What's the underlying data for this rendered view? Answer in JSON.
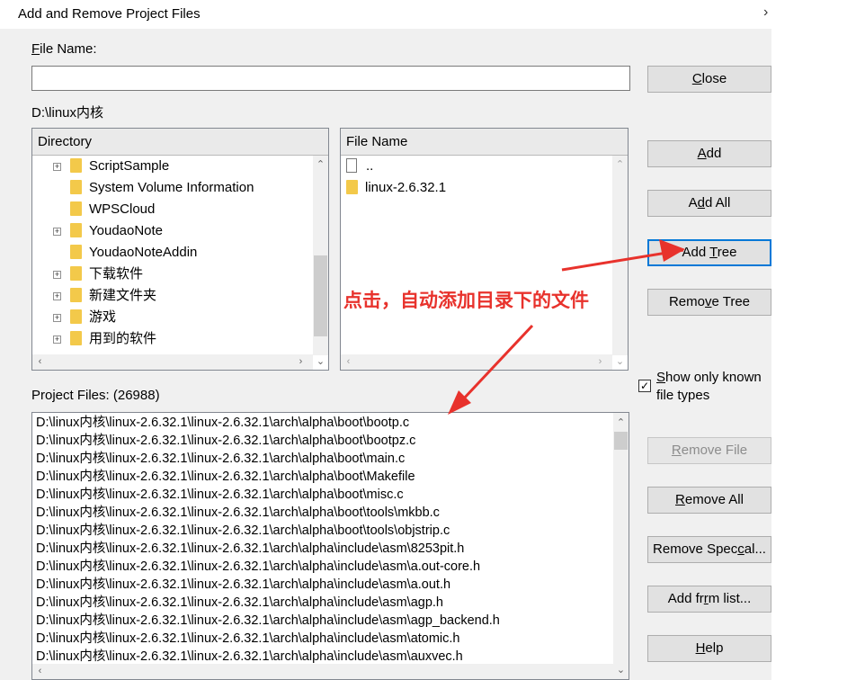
{
  "window": {
    "title": "Add and Remove Project Files",
    "close_glyph": "›"
  },
  "file_name": {
    "label": "File Name:",
    "value": ""
  },
  "current_path": "D:\\linux内核",
  "directory": {
    "header": "Directory",
    "items": [
      {
        "label": "ScriptSample",
        "expandable": true
      },
      {
        "label": "System Volume Information",
        "expandable": false
      },
      {
        "label": "WPSCloud",
        "expandable": false
      },
      {
        "label": "YoudaoNote",
        "expandable": true
      },
      {
        "label": "YoudaoNoteAddin",
        "expandable": false
      },
      {
        "label": "下载软件",
        "expandable": true
      },
      {
        "label": "新建文件夹",
        "expandable": true
      },
      {
        "label": "游戏",
        "expandable": true
      },
      {
        "label": "用到的软件",
        "expandable": true
      }
    ]
  },
  "file_list": {
    "header": "File Name",
    "items": [
      {
        "label": "..",
        "icon": "document-icon"
      },
      {
        "label": "linux-2.6.32.1",
        "icon": "folder-icon"
      }
    ]
  },
  "project_files": {
    "label": "Project Files: (26988)",
    "items": [
      "D:\\linux内核\\linux-2.6.32.1\\linux-2.6.32.1\\arch\\alpha\\boot\\bootp.c",
      "D:\\linux内核\\linux-2.6.32.1\\linux-2.6.32.1\\arch\\alpha\\boot\\bootpz.c",
      "D:\\linux内核\\linux-2.6.32.1\\linux-2.6.32.1\\arch\\alpha\\boot\\main.c",
      "D:\\linux内核\\linux-2.6.32.1\\linux-2.6.32.1\\arch\\alpha\\boot\\Makefile",
      "D:\\linux内核\\linux-2.6.32.1\\linux-2.6.32.1\\arch\\alpha\\boot\\misc.c",
      "D:\\linux内核\\linux-2.6.32.1\\linux-2.6.32.1\\arch\\alpha\\boot\\tools\\mkbb.c",
      "D:\\linux内核\\linux-2.6.32.1\\linux-2.6.32.1\\arch\\alpha\\boot\\tools\\objstrip.c",
      "D:\\linux内核\\linux-2.6.32.1\\linux-2.6.32.1\\arch\\alpha\\include\\asm\\8253pit.h",
      "D:\\linux内核\\linux-2.6.32.1\\linux-2.6.32.1\\arch\\alpha\\include\\asm\\a.out-core.h",
      "D:\\linux内核\\linux-2.6.32.1\\linux-2.6.32.1\\arch\\alpha\\include\\asm\\a.out.h",
      "D:\\linux内核\\linux-2.6.32.1\\linux-2.6.32.1\\arch\\alpha\\include\\asm\\agp.h",
      "D:\\linux内核\\linux-2.6.32.1\\linux-2.6.32.1\\arch\\alpha\\include\\asm\\agp_backend.h",
      "D:\\linux内核\\linux-2.6.32.1\\linux-2.6.32.1\\arch\\alpha\\include\\asm\\atomic.h",
      "D:\\linux内核\\linux-2.6.32.1\\linux-2.6.32.1\\arch\\alpha\\include\\asm\\auxvec.h"
    ]
  },
  "buttons": {
    "close": "Close",
    "add": "Add",
    "add_all": "Add All",
    "add_tree": "Add Tree",
    "remove_tree": "Remove Tree",
    "remove_file": "Remove File",
    "remove_all": "Remove All",
    "remove_special": "Remove Special...",
    "add_from_list": "Add from list...",
    "help": "Help"
  },
  "options": {
    "show_only_known_line1": "Show only known",
    "show_only_known_line2": "file types",
    "show_only_known_checked": true
  },
  "annotation": {
    "text": "点击，自动添加目录下的文件",
    "color": "#e8322c"
  }
}
